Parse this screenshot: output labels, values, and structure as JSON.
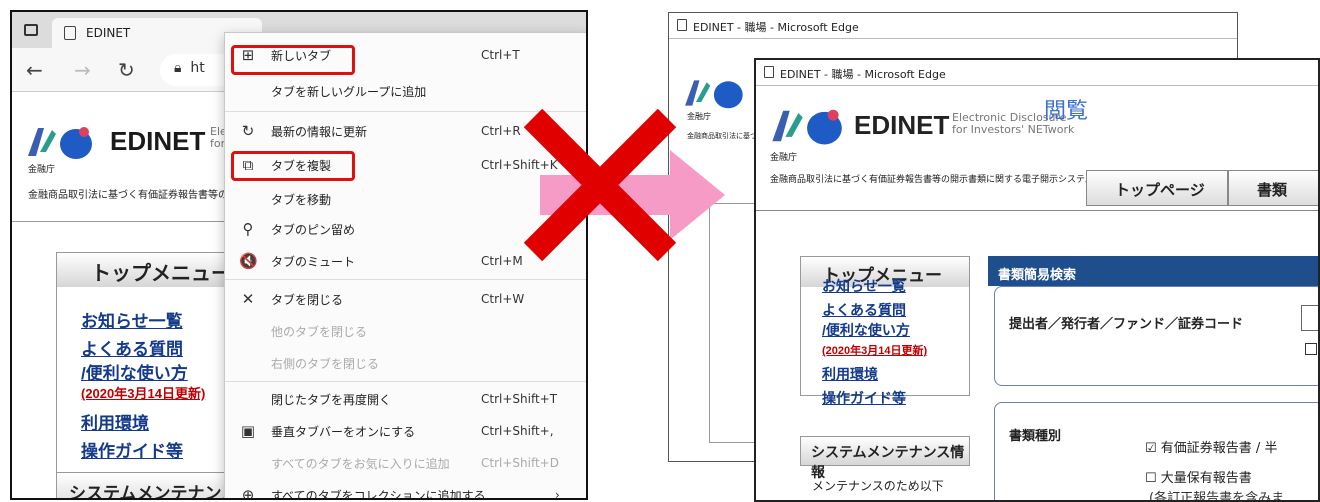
{
  "left": {
    "tab_title": "EDINET",
    "url_fragment": "ht",
    "site": {
      "logo": "EDINET",
      "logo_sub_1": "Ele",
      "logo_sub_2": "for",
      "agency": "金融庁",
      "tagline": "金融商品取引法に基づく有価証券報告書等の"
    },
    "top_menu": {
      "heading": "トップメニュー",
      "links": [
        "お知らせ一覧",
        "よくある質問",
        "/便利な使い方",
        "利用環境",
        "操作ガイド等"
      ],
      "updated": "(2020年3月14日更新)"
    },
    "maintenance_heading": "システムメンテナンス",
    "context_menu": [
      {
        "icon": "new-tab-icon",
        "glyph": "⊞",
        "label": "新しいタブ",
        "shortcut": "Ctrl+T",
        "disabled": false
      },
      {
        "icon": "",
        "glyph": "",
        "label": "タブを新しいグループに追加",
        "shortcut": "",
        "disabled": false
      },
      {
        "icon": "refresh-icon",
        "glyph": "↻",
        "label": "最新の情報に更新",
        "shortcut": "Ctrl+R",
        "disabled": false
      },
      {
        "icon": "duplicate-tab-icon",
        "glyph": "⧉",
        "label": "タブを複製",
        "shortcut": "Ctrl+Shift+K",
        "disabled": false
      },
      {
        "icon": "",
        "glyph": "",
        "label": "タブを移動",
        "shortcut": "",
        "disabled": false
      },
      {
        "icon": "pin-icon",
        "glyph": "⚲",
        "label": "タブのピン留め",
        "shortcut": "",
        "disabled": false
      },
      {
        "icon": "mute-icon",
        "glyph": "🔇",
        "label": "タブのミュート",
        "shortcut": "Ctrl+M",
        "disabled": false
      },
      {
        "icon": "close-icon",
        "glyph": "✕",
        "label": "タブを閉じる",
        "shortcut": "Ctrl+W",
        "disabled": false
      },
      {
        "icon": "",
        "glyph": "",
        "label": "他のタブを閉じる",
        "shortcut": "",
        "disabled": true
      },
      {
        "icon": "",
        "glyph": "",
        "label": "右側のタブを閉じる",
        "shortcut": "",
        "disabled": true
      },
      {
        "icon": "",
        "glyph": "",
        "label": "閉じたタブを再度開く",
        "shortcut": "Ctrl+Shift+T",
        "disabled": false
      },
      {
        "icon": "vertical-tabs-icon",
        "glyph": "▣",
        "label": "垂直タブバーをオンにする",
        "shortcut": "Ctrl+Shift+,",
        "disabled": false
      },
      {
        "icon": "",
        "glyph": "",
        "label": "すべてのタブをお気に入りに追加",
        "shortcut": "Ctrl+Shift+D",
        "disabled": true
      },
      {
        "icon": "collections-icon",
        "glyph": "⊕",
        "label": "すべてのタブをコレクションに追加する",
        "shortcut": "",
        "disabled": false
      }
    ]
  },
  "right": {
    "window_title": "EDINET - 職場 - Microsoft Edge",
    "site": {
      "logo": "EDINET",
      "logo_sub_1": "Electronic Disclosure",
      "logo_sub_2": "for Investors' NETwork",
      "kanji": "閲覧",
      "agency": "金融庁",
      "tagline": "金融商品取引法に基づく有価証券報告書等の開示書類に関する電子開示システム"
    },
    "buttons": [
      "トップページ",
      "書類"
    ],
    "top_menu": {
      "heading": "トップメニュー",
      "links": [
        "お知らせ一覧",
        "よくある質問",
        "/便利な使い方",
        "利用環境",
        "操作ガイド等"
      ],
      "updated": "(2020年3月14日更新)"
    },
    "maintenance_heading": "システムメンテナンス情報",
    "maintenance_text": "メンテナンスのため以下",
    "search_heading": "書類簡易検索",
    "filer_label": "提出者／発行者／ファンド／証券コード",
    "doc_type_label": "書類種別",
    "checks": [
      "有価証券報告書 / 半",
      "大量保有報告書"
    ],
    "note": "(各訂正報告書を含みま"
  }
}
